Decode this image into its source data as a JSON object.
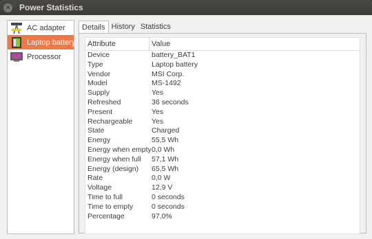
{
  "window": {
    "title": "Power Statistics",
    "close_glyph": "×"
  },
  "sidebar": {
    "items": [
      {
        "label": "AC adapter",
        "icon": "ac-adapter-icon"
      },
      {
        "label": "Laptop battery",
        "icon": "battery-icon"
      },
      {
        "label": "Processor",
        "icon": "processor-icon"
      }
    ],
    "selected_index": 1
  },
  "tabs": [
    "Details",
    "History",
    "Statistics"
  ],
  "active_tab": "Details",
  "table": {
    "headers": [
      "Attribute",
      "Value"
    ],
    "rows": [
      [
        "Device",
        "battery_BAT1"
      ],
      [
        "Type",
        "Laptop battery"
      ],
      [
        "Vendor",
        "MSI Corp."
      ],
      [
        "Model",
        "MS-1492"
      ],
      [
        "Supply",
        "Yes"
      ],
      [
        "Refreshed",
        "36 seconds"
      ],
      [
        "Present",
        "Yes"
      ],
      [
        "Rechargeable",
        "Yes"
      ],
      [
        "State",
        "Charged"
      ],
      [
        "Energy",
        "55,5 Wh"
      ],
      [
        "Energy when empty",
        "0,0 Wh"
      ],
      [
        "Energy when full",
        "57,1 Wh"
      ],
      [
        "Energy (design)",
        "65,5 Wh"
      ],
      [
        "Rate",
        "0,0 W"
      ],
      [
        "Voltage",
        "12,9 V"
      ],
      [
        "Time to full",
        "0 seconds"
      ],
      [
        "Time to empty",
        "0 seconds"
      ],
      [
        "Percentage",
        "97,0%"
      ]
    ]
  },
  "colors": {
    "selection": "#f07746",
    "titlebar": "#3c3b37",
    "window_bg": "#f2f1f0"
  }
}
